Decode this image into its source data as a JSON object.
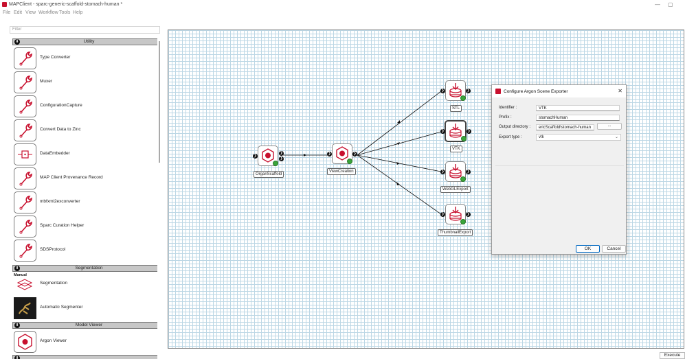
{
  "window": {
    "title": "MAPClient - sparc-generic-scaffold-stomach-human *",
    "minimize": "—",
    "maximize": "▢"
  },
  "menu": [
    "File",
    "Edit",
    "View",
    "Workflow",
    "Tools",
    "Help"
  ],
  "filter": {
    "placeholder": "Filter"
  },
  "categories": [
    {
      "name": "Utility",
      "items": [
        "Type Converter",
        "Muxer",
        "ConfigurationCapture",
        "Convert Data to Zinc",
        "DataEmbedder",
        "MAP Client Provenance Record",
        "mbfxml2exconverter",
        "Sparc Curation Helper",
        "SDSProtocol"
      ]
    },
    {
      "name": "Segmentation",
      "items": [
        "Segmentation",
        "Automatic Segmenter"
      ],
      "icon_text": "Manual"
    },
    {
      "name": "Model Viewer",
      "items": [
        "Argon Viewer"
      ]
    },
    {
      "name": ""
    }
  ],
  "workflow": {
    "nodes": [
      {
        "label": "OrganScaffold"
      },
      {
        "label": "ViewCreation"
      },
      {
        "label": "STL"
      },
      {
        "label": "VTK"
      },
      {
        "label": "WebGLExport"
      },
      {
        "label": "ThumbnailExport"
      }
    ],
    "port_symbol": "❯"
  },
  "dialog": {
    "title": "Configure Argon Scene Exporter",
    "close": "✕",
    "identifier_label": "Identifier :",
    "identifier_value": "VTK",
    "prefix_label": "Prefix :",
    "prefix_value": "stomachHuman",
    "output_label": "Output directory :",
    "output_value": "ericScaffold\\stomach-human",
    "browse_label": "...",
    "export_type_label": "Export type :",
    "export_type_value": "vtk",
    "ok_label": "OK",
    "cancel_label": "Cancel"
  },
  "execute_label": "Execute",
  "colors": {
    "accent": "#c8102e",
    "grid": "#bcd7e5",
    "status_ok": "#3aa53a"
  }
}
